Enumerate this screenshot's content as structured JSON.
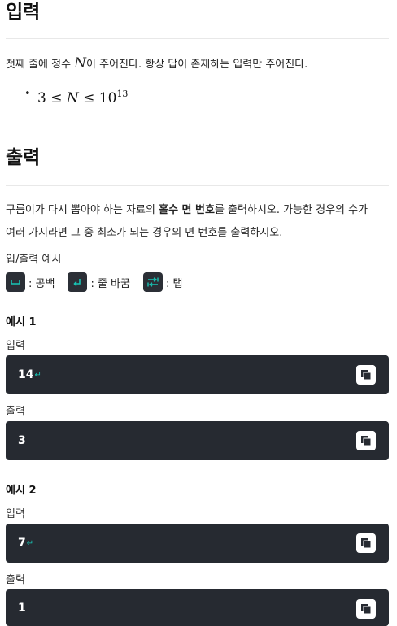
{
  "input_section": {
    "heading": "입력",
    "text_before": "첫째 줄에 정수 ",
    "var": "N",
    "text_after": "이 주어진다. 항상 답이 존재하는 입력만 주어진다.",
    "bullet": "•",
    "constraint": {
      "low": "3 ≤ ",
      "var": "N",
      "rel": " ≤ 10",
      "exp": "13"
    }
  },
  "output_section": {
    "heading": "출력",
    "line1_before": "구름이가 다시 뽑아야 하는 자료의 ",
    "line1_bold": "홀수 면 번호",
    "line1_after": "를 출력하시오. 가능한 경우의 수가",
    "line2": "여러 가지라면 그 중 최소가 되는 경우의 면 번호를 출력하시오."
  },
  "examples_header": "입/출력 예시",
  "legend": [
    {
      "icon": "space-icon",
      "label": ": 공백"
    },
    {
      "icon": "newline-icon",
      "label": ": 줄 바꿈"
    },
    {
      "icon": "tab-icon",
      "label": ": 탭"
    }
  ],
  "examples": [
    {
      "title": "예시 1",
      "input_label": "입력",
      "input": "14",
      "output_label": "출력",
      "output": "3"
    },
    {
      "title": "예시 2",
      "input_label": "입력",
      "input": "7",
      "output_label": "출력",
      "output": "1"
    }
  ],
  "colors": {
    "box_bg": "#262a31",
    "accent": "#18c5b5"
  }
}
